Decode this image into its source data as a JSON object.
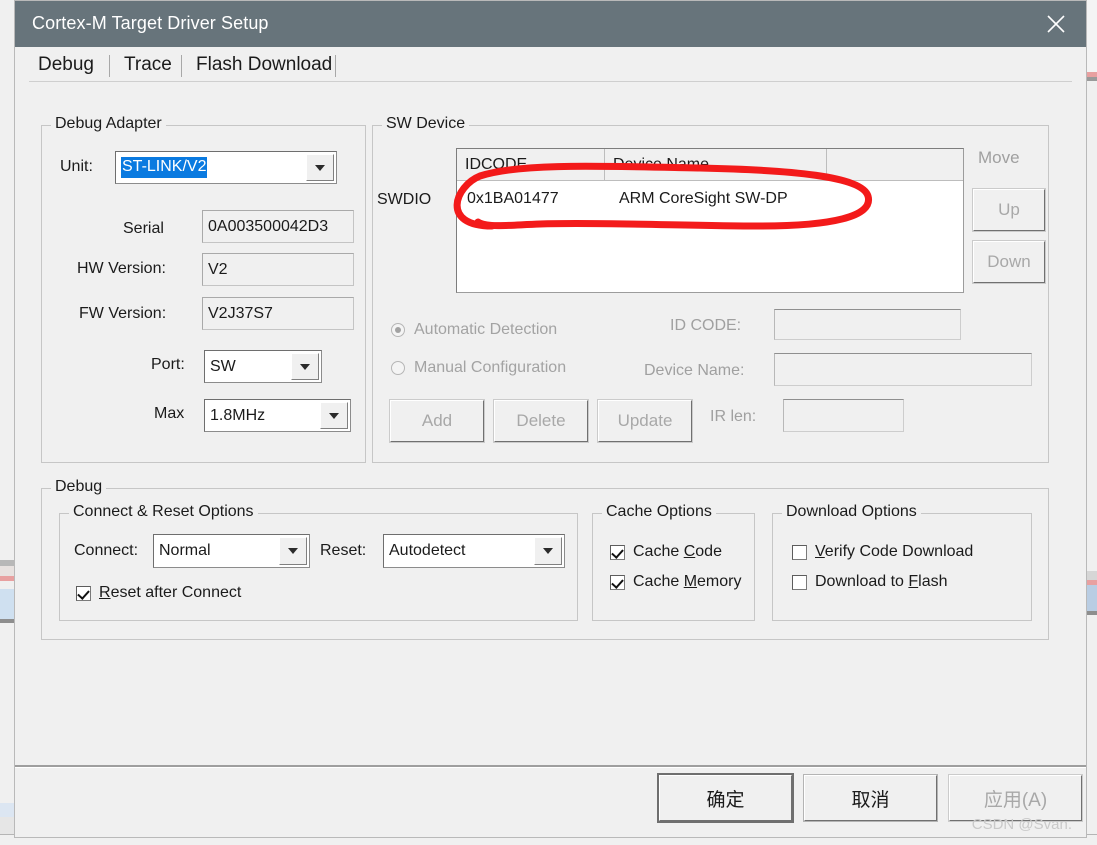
{
  "window": {
    "title": "Cortex-M Target Driver Setup",
    "close_icon": "close-icon"
  },
  "tabs": [
    {
      "label": "Debug",
      "active": true
    },
    {
      "label": "Trace",
      "active": false
    },
    {
      "label": "Flash Download",
      "active": false
    }
  ],
  "debug_adapter": {
    "group_title": "Debug Adapter",
    "unit_label": "Unit:",
    "unit_value": "ST-LINK/V2",
    "serial_label": "Serial",
    "serial_value": "0A003500042D3",
    "hw_version_label": "HW Version:",
    "hw_version_value": "V2",
    "fw_version_label": "FW Version:",
    "fw_version_value": "V2J37S7",
    "port_label": "Port:",
    "port_value": "SW",
    "max_label": "Max",
    "max_value": "1.8MHz"
  },
  "sw_device": {
    "group_title": "SW Device",
    "swdio_label": "SWDIO",
    "columns": [
      "IDCODE",
      "Device Name",
      ""
    ],
    "rows": [
      {
        "idcode": "0x1BA01477",
        "device_name": "ARM CoreSight SW-DP"
      }
    ],
    "move_label": "Move",
    "up_label": "Up",
    "down_label": "Down",
    "automatic_detection_label": "Automatic Detection",
    "manual_configuration_label": "Manual Configuration",
    "detection_mode": "automatic",
    "id_code_label": "ID CODE:",
    "id_code_value": "",
    "device_name_label": "Device Name:",
    "device_name_value": "",
    "ir_len_label": "IR len:",
    "ir_len_value": "",
    "add_label": "Add",
    "delete_label": "Delete",
    "update_label": "Update"
  },
  "debug_section": {
    "group_title": "Debug",
    "connect_reset": {
      "group_title": "Connect & Reset Options",
      "connect_label": "Connect:",
      "connect_value": "Normal",
      "reset_label": "Reset:",
      "reset_value": "Autodetect",
      "reset_after_connect_label": "Reset after Connect",
      "reset_after_connect_mnemonic": "R",
      "reset_after_connect_rest": "eset after Connect",
      "reset_after_connect_checked": true
    },
    "cache_options": {
      "group_title": "Cache Options",
      "cache_code_pre": "Cache ",
      "cache_code_mnemonic": "C",
      "cache_code_post": "ode",
      "cache_code_checked": true,
      "cache_memory_pre": "Cache ",
      "cache_memory_mnemonic": "M",
      "cache_memory_post": "emory",
      "cache_memory_checked": true
    },
    "download_options": {
      "group_title": "Download Options",
      "verify_mnemonic": "V",
      "verify_rest": "erify Code Download",
      "verify_checked": false,
      "download_flash_pre": "Download to ",
      "download_flash_mnemonic": "F",
      "download_flash_post": "lash",
      "download_flash_checked": false
    }
  },
  "footer": {
    "ok_label": "确定",
    "cancel_label": "取消",
    "apply_label": "应用(A)"
  },
  "annotation": {
    "type": "hand-drawn-ellipse",
    "color": "#f31a1a",
    "target": "ARM CoreSight SW-DP device row"
  },
  "watermark": {
    "text": "CSDN @Svan."
  },
  "background": {
    "bottom_text": ""
  }
}
